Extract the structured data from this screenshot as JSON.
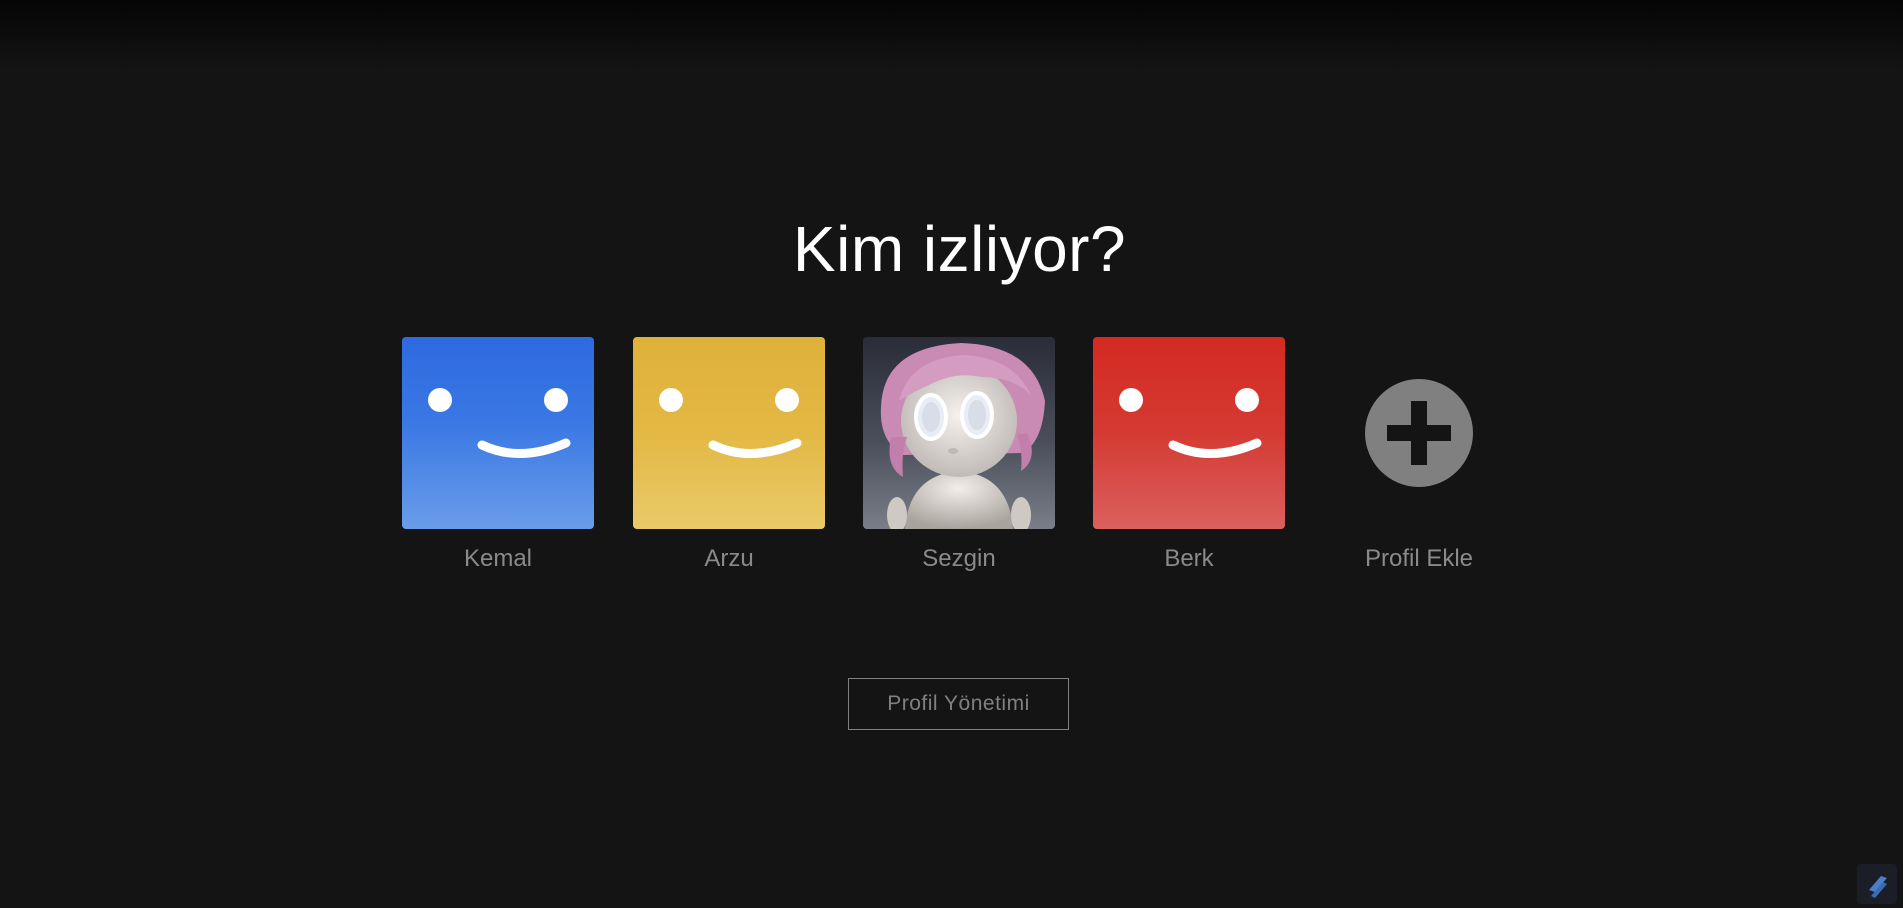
{
  "heading": "Kim izliyor?",
  "profiles": [
    {
      "name": "Kemal",
      "icon": "smiley-avatar-blue-icon",
      "color": "#2d6ae0"
    },
    {
      "name": "Arzu",
      "icon": "smiley-avatar-yellow-icon",
      "color": "#deb13a"
    },
    {
      "name": "Sezgin",
      "icon": "robot-avatar-icon",
      "color": "#e8a0c8"
    },
    {
      "name": "Berk",
      "icon": "smiley-avatar-red-icon",
      "color": "#d32a22"
    }
  ],
  "add_profile": {
    "label": "Profil Ekle",
    "icon": "plus-circle-icon"
  },
  "manage_button": "Profil Yönetimi",
  "colors": {
    "background": "#141414",
    "heading": "#ffffff",
    "muted_text": "#808080"
  }
}
